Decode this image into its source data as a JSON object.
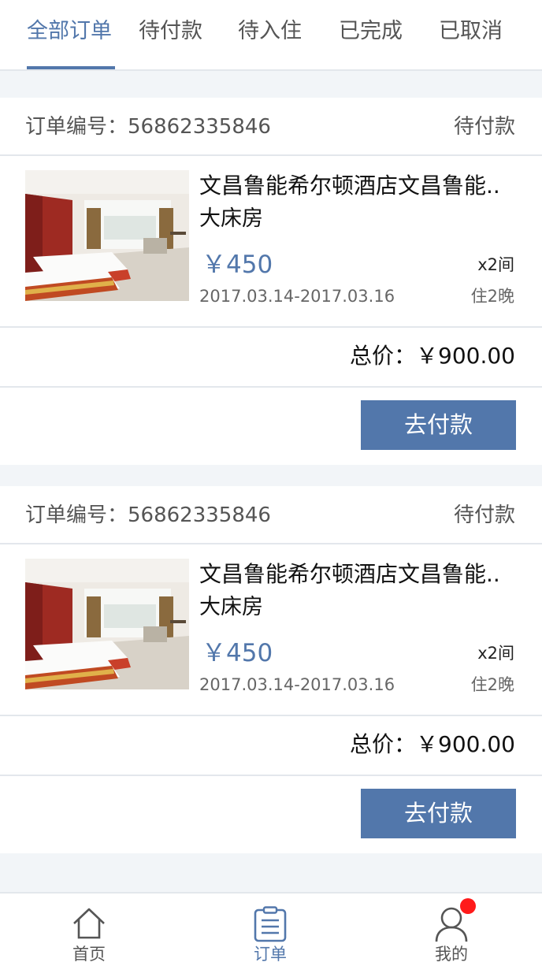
{
  "tabs": [
    {
      "label": "全部订单",
      "active": true
    },
    {
      "label": "待付款",
      "active": false
    },
    {
      "label": "待入住",
      "active": false
    },
    {
      "label": "已完成",
      "active": false
    },
    {
      "label": "已取消",
      "active": false
    }
  ],
  "orders": [
    {
      "number_label": "订单编号：56862335846",
      "status": "待付款",
      "hotel_name": "文昌鲁能希尔顿酒店文昌鲁能..",
      "room_type": "大床房",
      "price": "￥450",
      "quantity": "x2间",
      "dates": "2017.03.14-2017.03.16",
      "nights": "住2晚",
      "total": "总价：￥900.00",
      "pay_label": "去付款"
    },
    {
      "number_label": "订单编号：56862335846",
      "status": "待付款",
      "hotel_name": "文昌鲁能希尔顿酒店文昌鲁能..",
      "room_type": "大床房",
      "price": "￥450",
      "quantity": "x2间",
      "dates": "2017.03.14-2017.03.16",
      "nights": "住2晚",
      "total": "总价：￥900.00",
      "pay_label": "去付款"
    }
  ],
  "bottom_nav": [
    {
      "label": "首页",
      "icon": "home-icon",
      "active": false
    },
    {
      "label": "订单",
      "icon": "clipboard-icon",
      "active": true
    },
    {
      "label": "我的",
      "icon": "user-icon",
      "active": false,
      "badge": true
    }
  ],
  "colors": {
    "accent": "#5277ab",
    "badge": "#ff1a1a"
  }
}
